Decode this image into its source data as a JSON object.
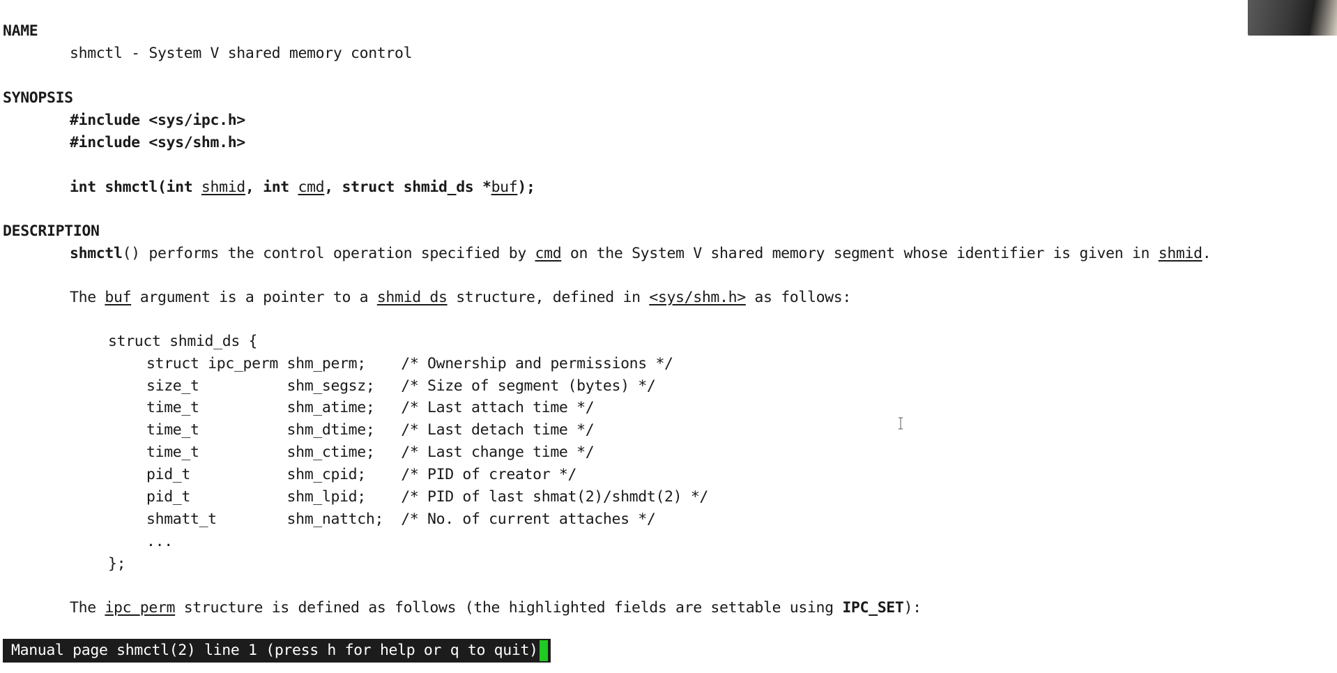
{
  "page": {
    "sections": {
      "name_heading": "NAME",
      "name_text": "shmctl - System V shared memory control",
      "synopsis_heading": "SYNOPSIS",
      "include1": "#include <sys/ipc.h>",
      "include2": "#include <sys/shm.h>",
      "proto_a": "int shmctl(int ",
      "proto_shmid": "shmid",
      "proto_b": ", int ",
      "proto_cmd": "cmd",
      "proto_c": ", struct shmid_ds *",
      "proto_buf": "buf",
      "proto_d": ");",
      "description_heading": "DESCRIPTION",
      "desc1_func": "shmctl",
      "desc1_a": "() performs the control operation specified by ",
      "desc1_cmd": "cmd",
      "desc1_b": " on the System V shared memory segment whose identifier is given in ",
      "desc1_shmid": "shmid",
      "desc1_c": ".",
      "desc2_a": "The ",
      "desc2_buf": "buf",
      "desc2_b": " argument is a pointer to a ",
      "desc2_shmid_ds": "shmid_ds",
      "desc2_c": " structure, defined in ",
      "desc2_header": "<sys/shm.h>",
      "desc2_d": " as follows:",
      "struct_open": "struct shmid_ds {",
      "struct_close": "};",
      "struct_ellipsis": "...",
      "last_a": "The ",
      "last_ipc_perm": "ipc_perm",
      "last_b": " structure is defined as follows (the highlighted fields are settable using ",
      "last_ipc_set": "IPC_SET",
      "last_c": "):"
    },
    "struct_fields": [
      {
        "text": "struct ipc_perm shm_perm;    /* Ownership and permissions */"
      },
      {
        "text": "size_t          shm_segsz;   /* Size of segment (bytes) */"
      },
      {
        "text": "time_t          shm_atime;   /* Last attach time */"
      },
      {
        "text": "time_t          shm_dtime;   /* Last detach time */"
      },
      {
        "text": "time_t          shm_ctime;   /* Last change time */"
      },
      {
        "text": "pid_t           shm_cpid;    /* PID of creator */"
      },
      {
        "text": "pid_t           shm_lpid;    /* PID of last shmat(2)/shmdt(2) */"
      },
      {
        "text": "shmatt_t        shm_nattch;  /* No. of current attaches */"
      }
    ],
    "status": "Manual page shmctl(2) line 1 (press h for help or q to quit)"
  },
  "colors": {
    "background": "#ffffff",
    "text": "#1a1a1a",
    "status_bg": "#1c1c1c",
    "status_fg": "#ffffff",
    "cursor": "#22c922"
  },
  "icons": {
    "pointer": "i-beam-cursor-icon"
  }
}
